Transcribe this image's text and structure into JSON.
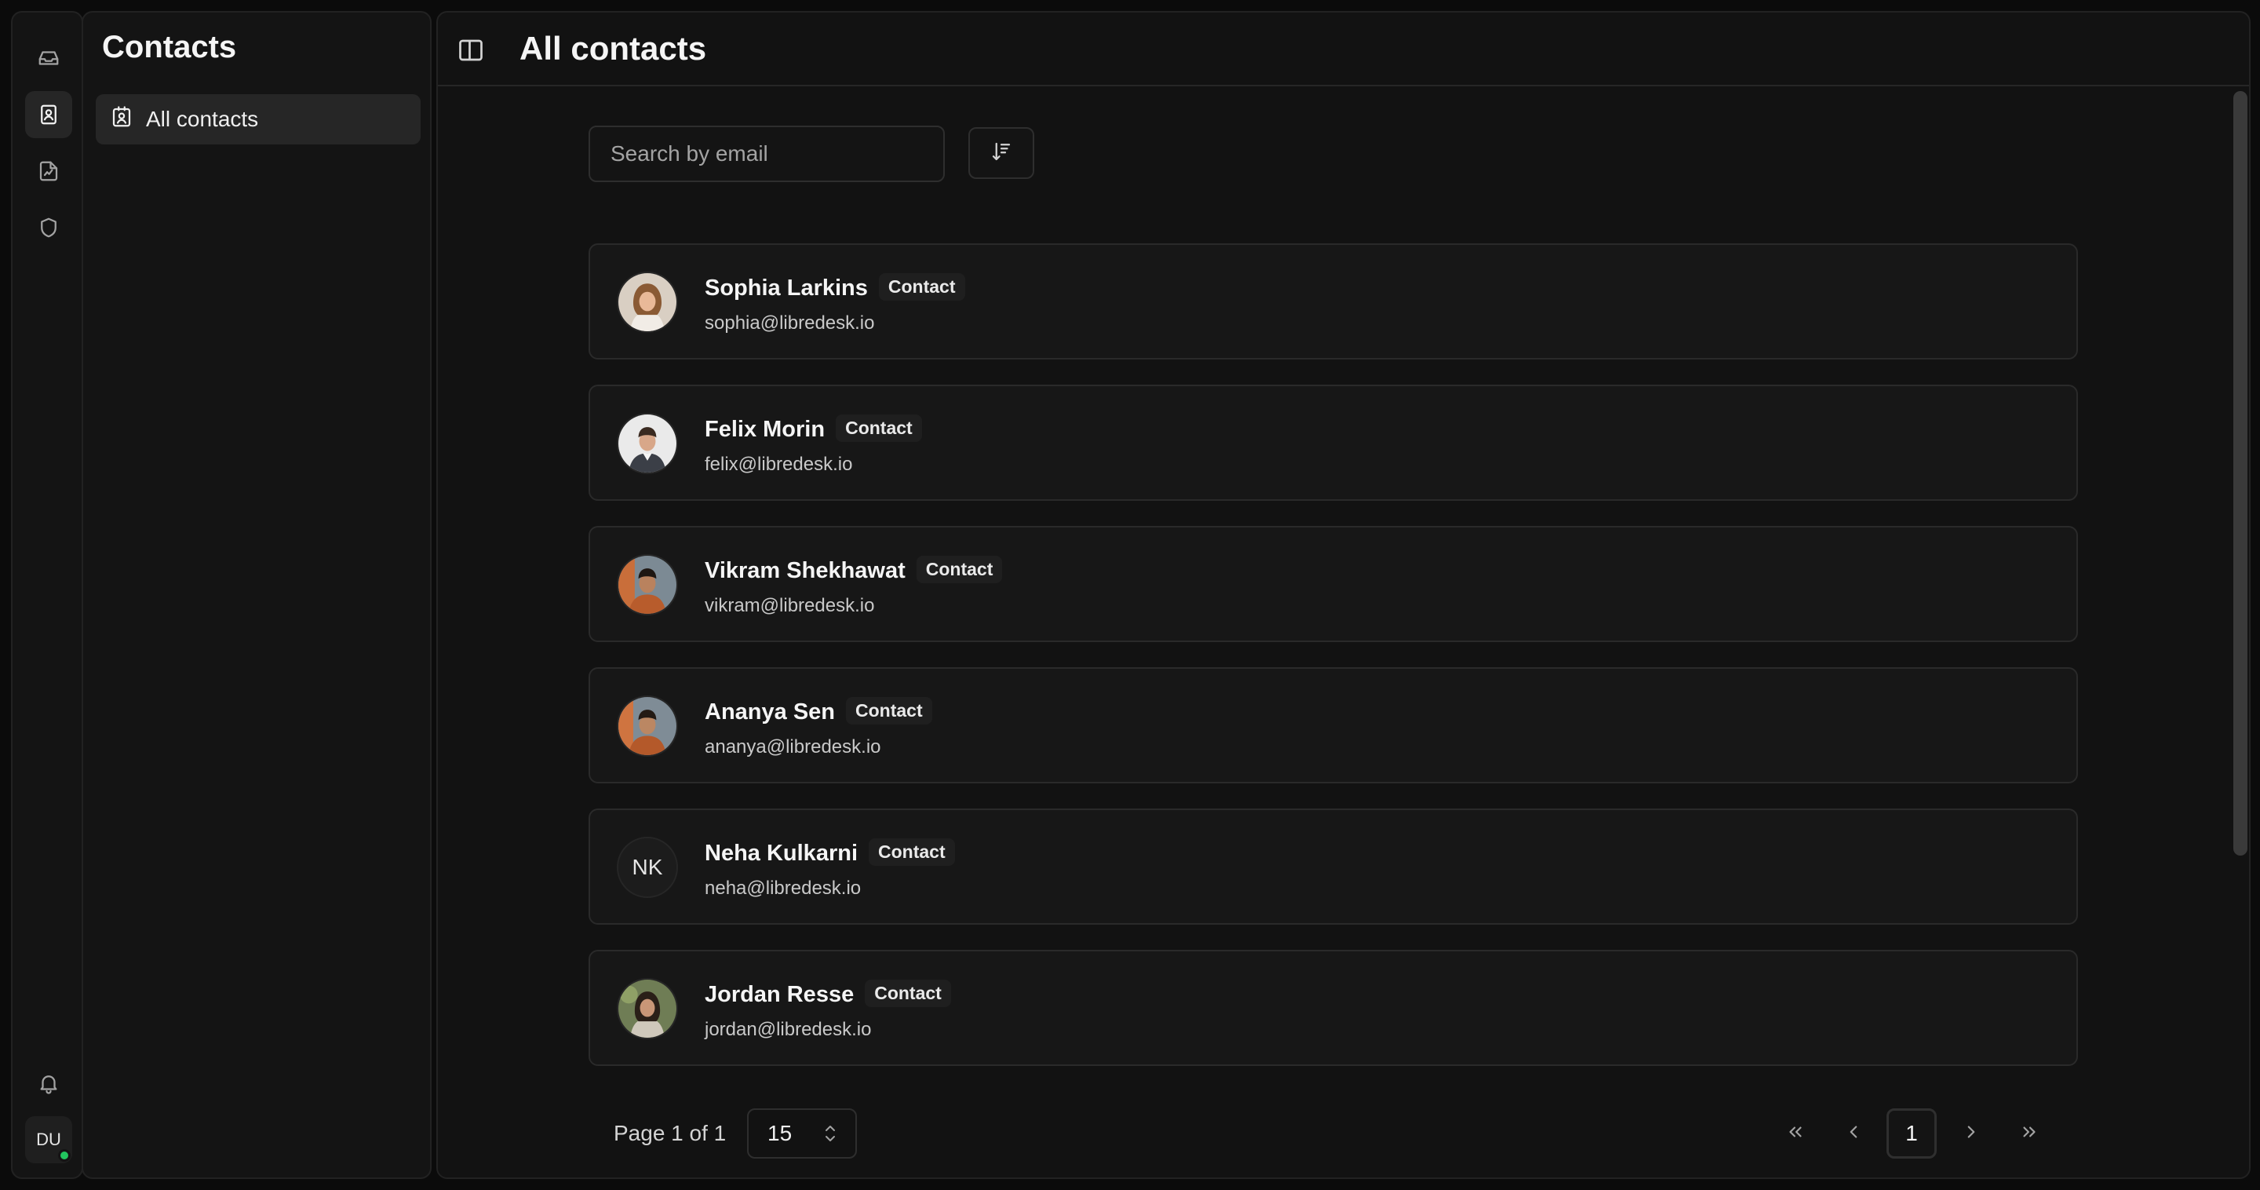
{
  "rail": {
    "items": [
      {
        "icon": "inbox-icon",
        "active": false
      },
      {
        "icon": "contacts-icon",
        "active": true
      },
      {
        "icon": "reports-icon",
        "active": false
      },
      {
        "icon": "shield-icon",
        "active": false
      }
    ],
    "user_initials": "DU",
    "user_status_color": "#22c55e"
  },
  "sidebar": {
    "title": "Contacts",
    "items": [
      {
        "label": "All contacts",
        "icon": "contact-card-icon",
        "active": true
      }
    ]
  },
  "header": {
    "title": "All contacts"
  },
  "search": {
    "placeholder": "Search by email",
    "value": ""
  },
  "contacts": [
    {
      "name": "Sophia Larkins",
      "badge": "Contact",
      "email": "sophia@libredesk.io",
      "avatar": "photo"
    },
    {
      "name": "Felix Morin",
      "badge": "Contact",
      "email": "felix@libredesk.io",
      "avatar": "photo"
    },
    {
      "name": "Vikram Shekhawat",
      "badge": "Contact",
      "email": "vikram@libredesk.io",
      "avatar": "photo"
    },
    {
      "name": "Ananya Sen",
      "badge": "Contact",
      "email": "ananya@libredesk.io",
      "avatar": "photo"
    },
    {
      "name": "Neha Kulkarni",
      "badge": "Contact",
      "email": "neha@libredesk.io",
      "avatar": "initials",
      "initials": "NK"
    },
    {
      "name": "Jordan Resse",
      "badge": "Contact",
      "email": "jordan@libredesk.io",
      "avatar": "photo"
    }
  ],
  "pagination": {
    "page_info": "Page 1 of 1",
    "per_page": "15",
    "current_page": "1"
  }
}
